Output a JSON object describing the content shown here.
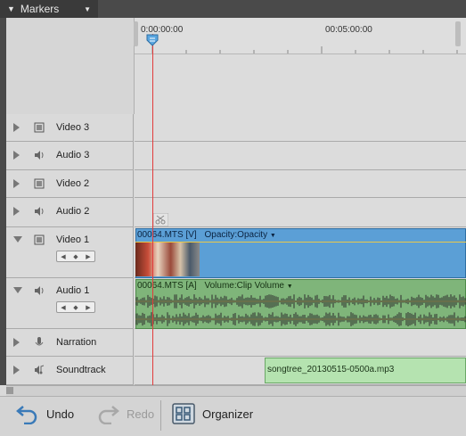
{
  "markers_panel": {
    "title": "Markers"
  },
  "ruler": {
    "time_start": "0:00:00:00",
    "time_mid": "00:05:00:00"
  },
  "tracks": [
    {
      "name": "Video 3",
      "kind": "video",
      "expanded": false
    },
    {
      "name": "Audio 3",
      "kind": "audio",
      "expanded": false
    },
    {
      "name": "Video 2",
      "kind": "video",
      "expanded": false
    },
    {
      "name": "Audio 2",
      "kind": "audio",
      "expanded": false
    },
    {
      "name": "Video 1",
      "kind": "video",
      "expanded": true
    },
    {
      "name": "Audio 1",
      "kind": "audio",
      "expanded": true
    },
    {
      "name": "Narration",
      "kind": "narration",
      "expanded": false
    },
    {
      "name": "Soundtrack",
      "kind": "soundtrack",
      "expanded": false
    }
  ],
  "clips": {
    "video": {
      "title": "00064.MTS [V]",
      "effect": "Opacity:Opacity"
    },
    "audio": {
      "title": "00064.MTS [A]",
      "effect": "Volume:Clip Volume"
    },
    "soundtrack": {
      "title": "songtree_20130515-0500a.mp3"
    }
  },
  "toolbar": {
    "undo_label": "Undo",
    "redo_label": "Redo",
    "organizer_label": "Organizer"
  },
  "colors": {
    "video_clip": "#5b9fd6",
    "audio_clip": "#7fb57a",
    "soundtrack_clip": "#b5e3b0",
    "playhead": "#e23b3b"
  },
  "icons": [
    "expand-triangle-icon",
    "film-icon",
    "speaker-icon",
    "microphone-icon",
    "music-note-icon",
    "scissors-icon",
    "undo-icon",
    "redo-icon",
    "organizer-icon"
  ]
}
